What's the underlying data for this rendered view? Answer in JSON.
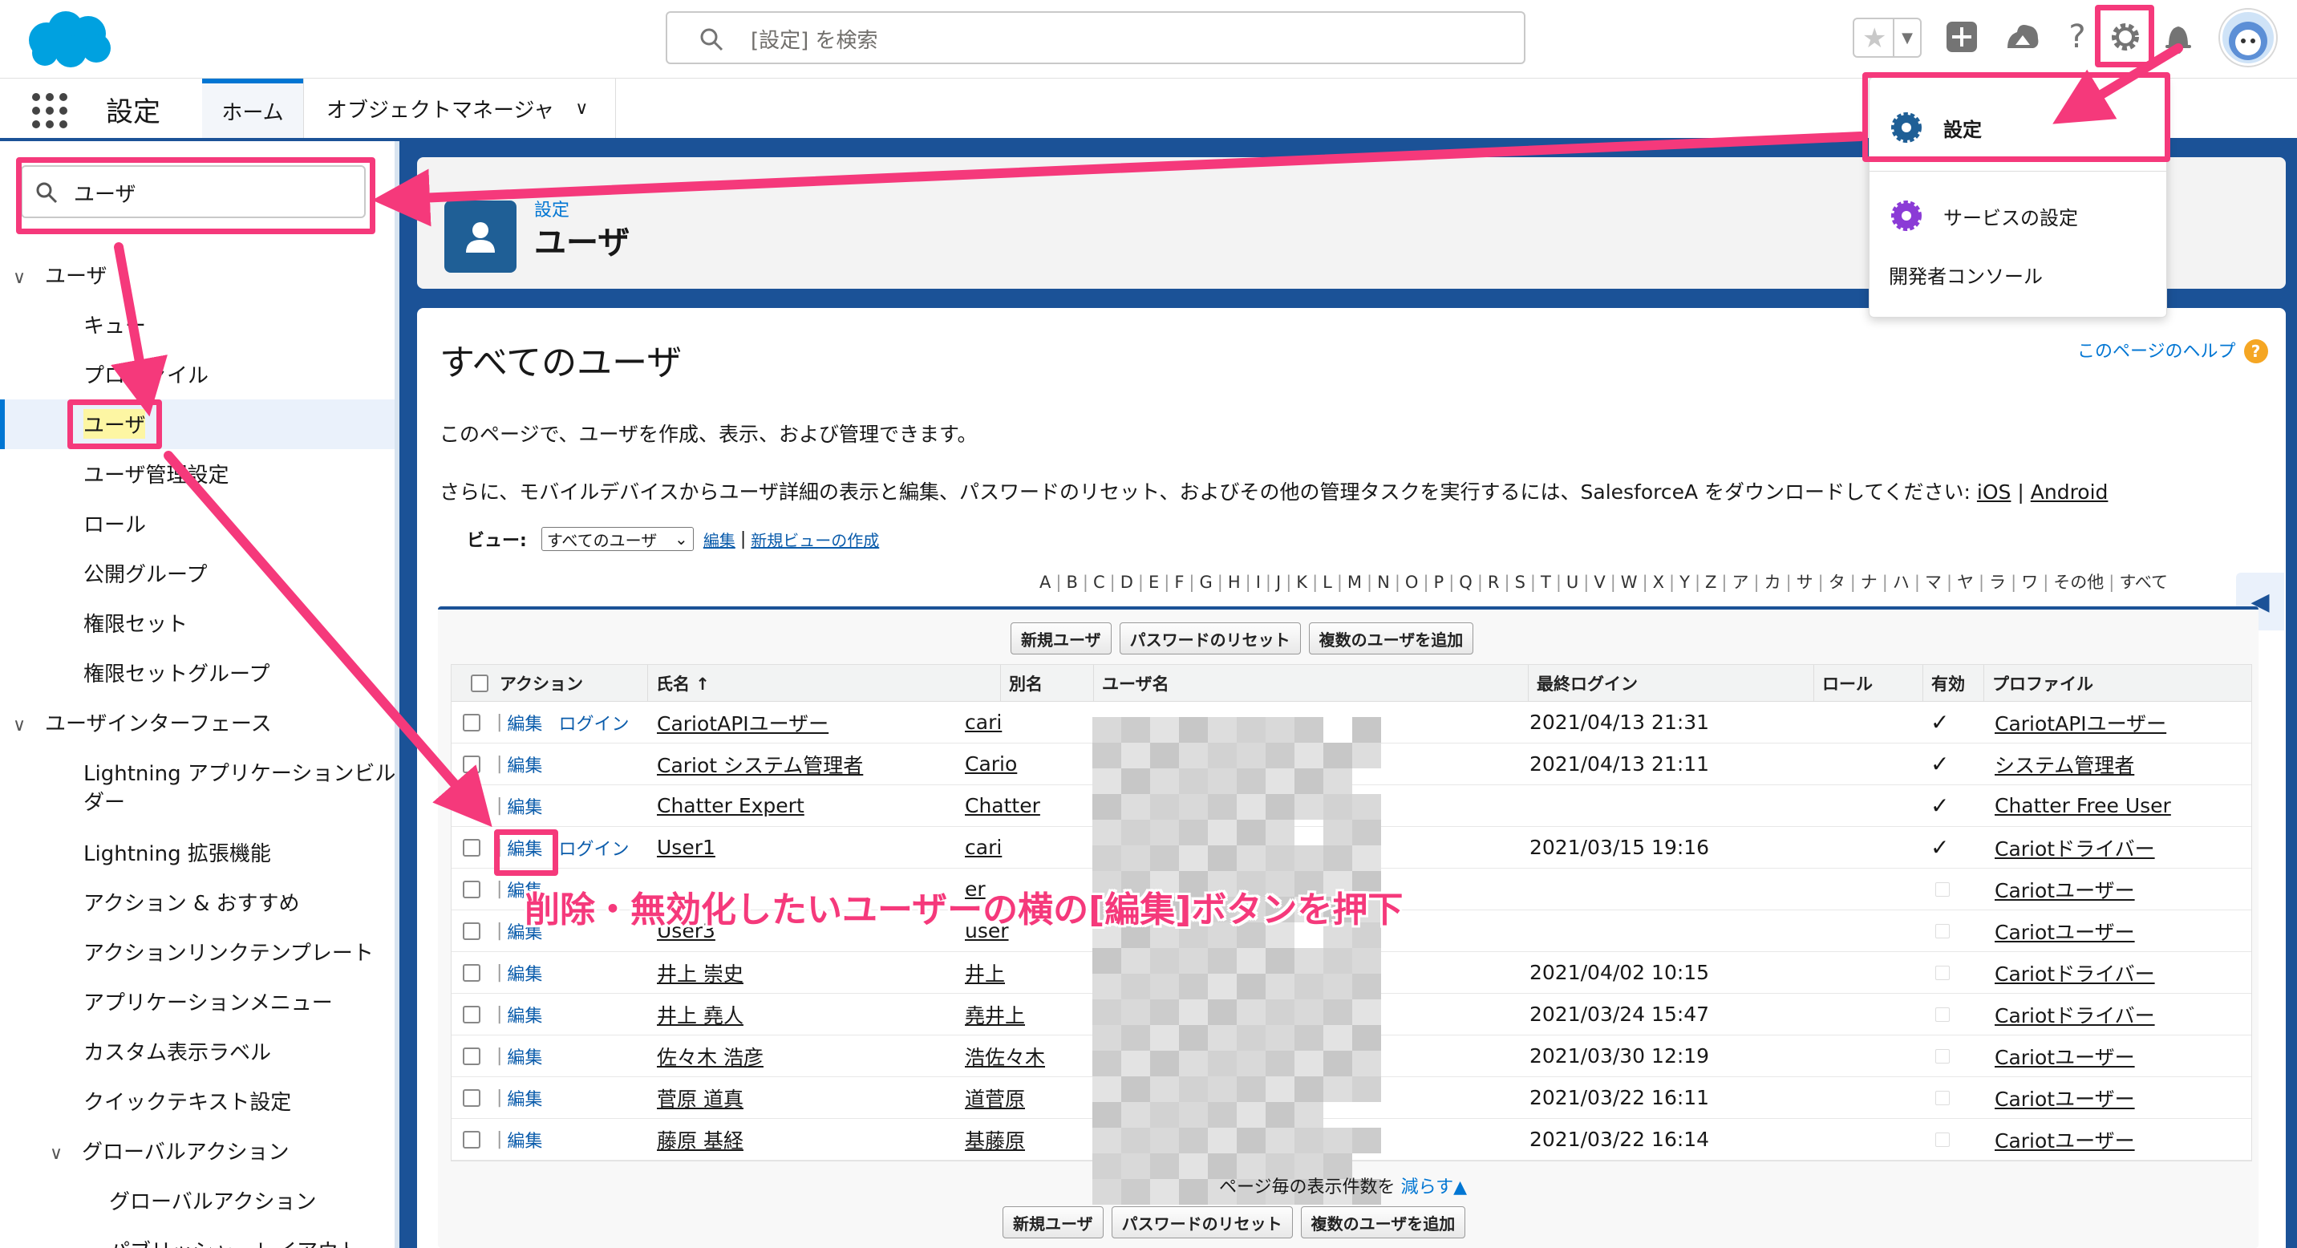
{
  "header": {
    "search_placeholder": "[設定] を検索"
  },
  "nav": {
    "app_name": "設定",
    "tabs": [
      "ホーム",
      "オブジェクトマネージャ"
    ]
  },
  "sidebar": {
    "quickfind_value": "ユーザ",
    "items": [
      {
        "label": "ユーザ"
      },
      {
        "label": "キュー"
      },
      {
        "label": "プロファイル"
      },
      {
        "label": "ユーザ"
      },
      {
        "label": "ユーザ管理設定"
      },
      {
        "label": "ロール"
      },
      {
        "label": "公開グループ"
      },
      {
        "label": "権限セット"
      },
      {
        "label": "権限セットグループ"
      },
      {
        "label": "ユーザインターフェース"
      },
      {
        "label": "Lightning アプリケーションビル"
      },
      {
        "label": "ダー"
      },
      {
        "label": "Lightning 拡張機能"
      },
      {
        "label": "アクション & おすすめ"
      },
      {
        "label": "アクションリンクテンプレート"
      },
      {
        "label": "アプリケーションメニュー"
      },
      {
        "label": "カスタム表示ラベル"
      },
      {
        "label": "クイックテキスト設定"
      },
      {
        "label": "グローバルアクション"
      },
      {
        "label": "グローバルアクション"
      },
      {
        "label": "パブリッシャーレイアウト"
      }
    ]
  },
  "page_header": {
    "breadcrumb": "設定",
    "title": "ユーザ"
  },
  "main": {
    "help_link": "このページのヘルプ",
    "help_icon": "?",
    "title": "すべてのユーザ",
    "desc1": "このページで、ユーザを作成、表示、および管理できます。",
    "desc2": "さらに、モバイルデバイスからユーザ詳細の表示と編集、パスワードのリセット、およびその他の管理タスクを実行するには、SalesforceA をダウンロードしてください: ",
    "ios": "iOS",
    "sep": " | ",
    "android": "Android",
    "view_label": "ビュー:",
    "view_selected": "すべてのユーザ",
    "view_edit": "編集",
    "view_new": "新規ビューの作成",
    "alphabet": [
      "A",
      "B",
      "C",
      "D",
      "E",
      "F",
      "G",
      "H",
      "I",
      "J",
      "K",
      "L",
      "M",
      "N",
      "O",
      "P",
      "Q",
      "R",
      "S",
      "T",
      "U",
      "V",
      "W",
      "X",
      "Y",
      "Z",
      "ア",
      "カ",
      "サ",
      "タ",
      "ナ",
      "ハ",
      "マ",
      "ヤ",
      "ラ",
      "ワ",
      "その他",
      "すべて"
    ],
    "buttons": [
      "新規ユーザ",
      "パスワードのリセット",
      "複数のユーザを追加"
    ],
    "columns": [
      "アクション",
      "氏名 ↑",
      "別名",
      "ユーザ名",
      "最終ログイン",
      "ロール",
      "有効",
      "プロファイル"
    ],
    "rows": [
      {
        "edit": "編集",
        "login": "ログイン",
        "name": "CariotAPIユーザー",
        "alias": "cari",
        "last_login": "2021/04/13 21:31",
        "active": "✓",
        "profile": "CariotAPIユーザー"
      },
      {
        "edit": "編集",
        "login": "",
        "name": "Cariot システム管理者",
        "alias": "Cario",
        "last_login": "2021/04/13 21:11",
        "active": "✓",
        "profile": "システム管理者"
      },
      {
        "edit": "編集",
        "login": "",
        "name": "Chatter Expert",
        "alias": "Chatter",
        "last_login": "",
        "active": "✓",
        "profile": "Chatter Free User"
      },
      {
        "edit": "編集",
        "login": "ログイン",
        "name": "User1",
        "alias": "cari",
        "last_login": "2021/03/15 19:16",
        "active": "✓",
        "profile": "Cariotドライバー"
      },
      {
        "edit": "編集",
        "login": "",
        "name": "",
        "alias": "er",
        "last_login": "",
        "active": "",
        "profile": "Cariotユーザー"
      },
      {
        "edit": "編集",
        "login": "",
        "name": "User3",
        "alias": "user",
        "last_login": "",
        "active": "",
        "profile": "Cariotユーザー"
      },
      {
        "edit": "編集",
        "login": "",
        "name": "井上 崇史",
        "alias": "井上",
        "last_login": "2021/04/02 10:15",
        "active": "",
        "profile": "Cariotドライバー"
      },
      {
        "edit": "編集",
        "login": "",
        "name": "井上 堯人",
        "alias": "堯井上",
        "last_login": "2021/03/24 15:47",
        "active": "",
        "profile": "Cariotドライバー"
      },
      {
        "edit": "編集",
        "login": "",
        "name": "佐々木 浩彦",
        "alias": "浩佐々木",
        "last_login": "2021/03/30 12:19",
        "active": "",
        "profile": "Cariotユーザー"
      },
      {
        "edit": "編集",
        "login": "",
        "name": "菅原 道真",
        "alias": "道菅原",
        "last_login": "2021/03/22 16:11",
        "active": "",
        "profile": "Cariotユーザー"
      },
      {
        "edit": "編集",
        "login": "",
        "name": "藤原 基経",
        "alias": "基藤原",
        "last_login": "2021/03/22 16:14",
        "active": "",
        "profile": "Cariotユーザー"
      }
    ],
    "per_page_label": "ページ毎の表示件数を ",
    "per_page_link": "減らす"
  },
  "settings_menu": {
    "items": [
      "設定",
      "サービスの設定",
      "開発者コンソール"
    ]
  },
  "annotation": {
    "text": "削除・無効化したいユーザーの横の[編集]ボタンを押下",
    "color": "#f5397b"
  },
  "colors": {
    "brand_blue": "#0176d3",
    "bg_blue": "#1b5297",
    "highlight": "#fdf6a3"
  }
}
